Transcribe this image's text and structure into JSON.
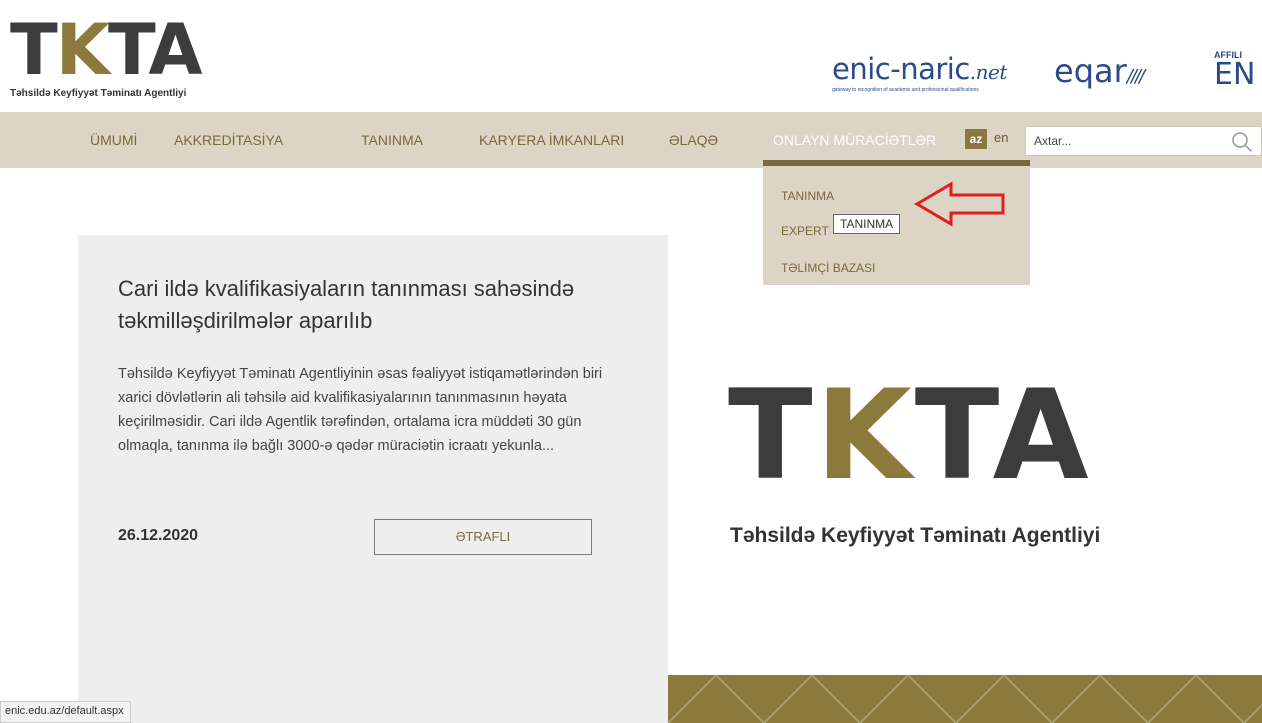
{
  "header": {
    "logo": {
      "letters": [
        "T",
        "K",
        "TA"
      ],
      "tagline": "Təhsildə Keyfiyyət Təminatı Agentliyi"
    },
    "partners": {
      "enic": {
        "name": "enic-naric",
        "suffix": ".net",
        "tagline": "gateway to recognition of academic and professional qualifications"
      },
      "eqar": {
        "name": "eqar",
        "stripes": "////"
      },
      "affiliate": {
        "small": "AFFILI",
        "big": "EN"
      }
    }
  },
  "nav": {
    "items": [
      {
        "label": "ÜMUMİ",
        "active": false
      },
      {
        "label": "AKKREDİTASİYA",
        "active": false
      },
      {
        "label": "TANINMA",
        "active": false
      },
      {
        "label": "KARYERA İMKANLARI",
        "active": false
      },
      {
        "label": "ƏLAQƏ",
        "active": false
      },
      {
        "label": "ONLAYN MÜRACİƏTLƏR",
        "active": true
      }
    ],
    "lang_active": "az",
    "lang_other": "en",
    "search_placeholder": "Axtar..."
  },
  "dropdown": {
    "items": [
      "TANINMA",
      "EXPERT",
      "TƏLİMÇİ BAZASI"
    ],
    "tooltip": "TANINMA"
  },
  "news": {
    "title": "Cari ildə kvalifikasiyaların tanınması sahəsində təkmilləşdirilmələr aparılıb",
    "excerpt": "Təhsildə Keyfiyyət Təminatı Agentliyinin əsas fəaliyyət istiqamətlərindən biri xarici dövlətlərin ali təhsilə aid kvalifikasiyalarının tanınmasının həyata keçirilməsidir. Cari ildə Agentlik tərəfindən, ortalama icra müddəti 30 gün olmaqla, tanınma ilə bağlı 3000-ə qədər müraciətin icraatı yekunla...",
    "date": "26.12.2020",
    "more_label": "ƏTRAFLI"
  },
  "hero_logo": {
    "letters": [
      "T",
      "K",
      "TA"
    ],
    "tagline": "Təhsildə Keyfiyyət Təminatı Agentliyi"
  },
  "status_url": "enic.edu.az/default.aspx",
  "colors": {
    "gold": "#8c7a3c",
    "nav_bg": "#dcd5c6",
    "nav_text": "#7a6a3a",
    "logo_dark": "#3c3c3c",
    "annotation_red": "#e02020",
    "partner_blue": "#2a4a8a"
  }
}
